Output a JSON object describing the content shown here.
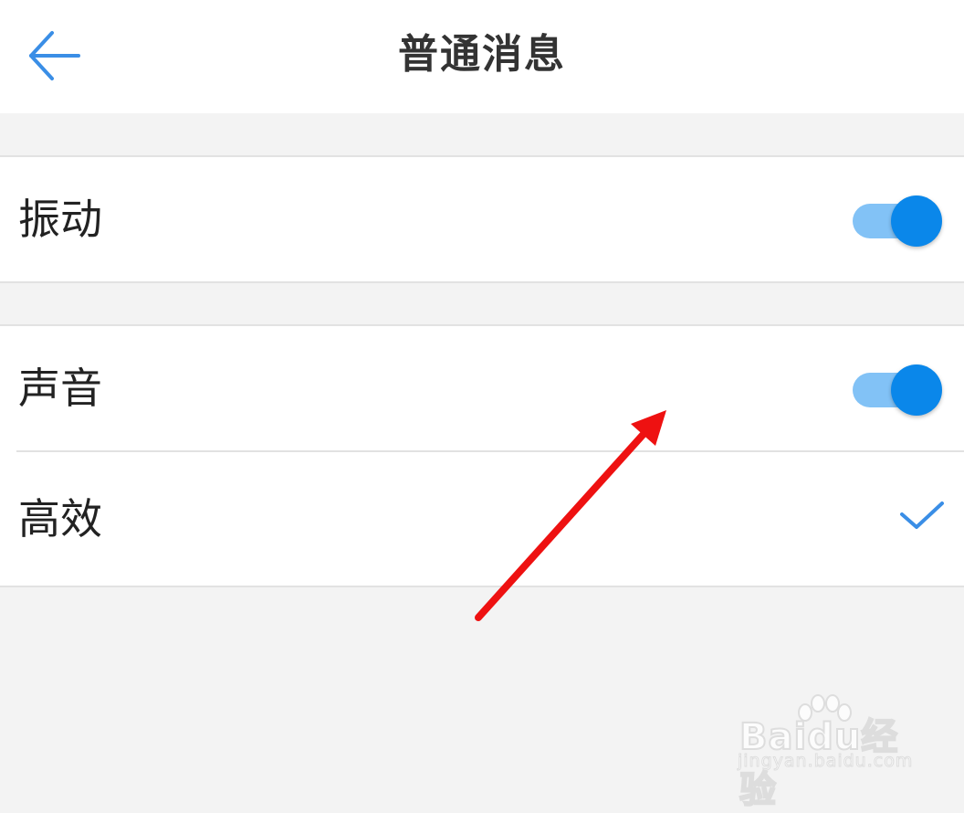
{
  "header": {
    "title": "普通消息",
    "back_icon": "arrow-left-icon"
  },
  "settings": {
    "vibration": {
      "label": "振动",
      "enabled": true
    },
    "sound": {
      "label": "声音",
      "enabled": true
    },
    "efficient": {
      "label": "高效",
      "selected": true
    }
  },
  "colors": {
    "accent": "#0a87ea",
    "toggle_track": "#82c2f6",
    "annotation_arrow": "#ee1111",
    "background": "#f3f3f3"
  },
  "watermark": {
    "logo_text": "Baidu经验",
    "url_text": "jingyan.baidu.com"
  }
}
